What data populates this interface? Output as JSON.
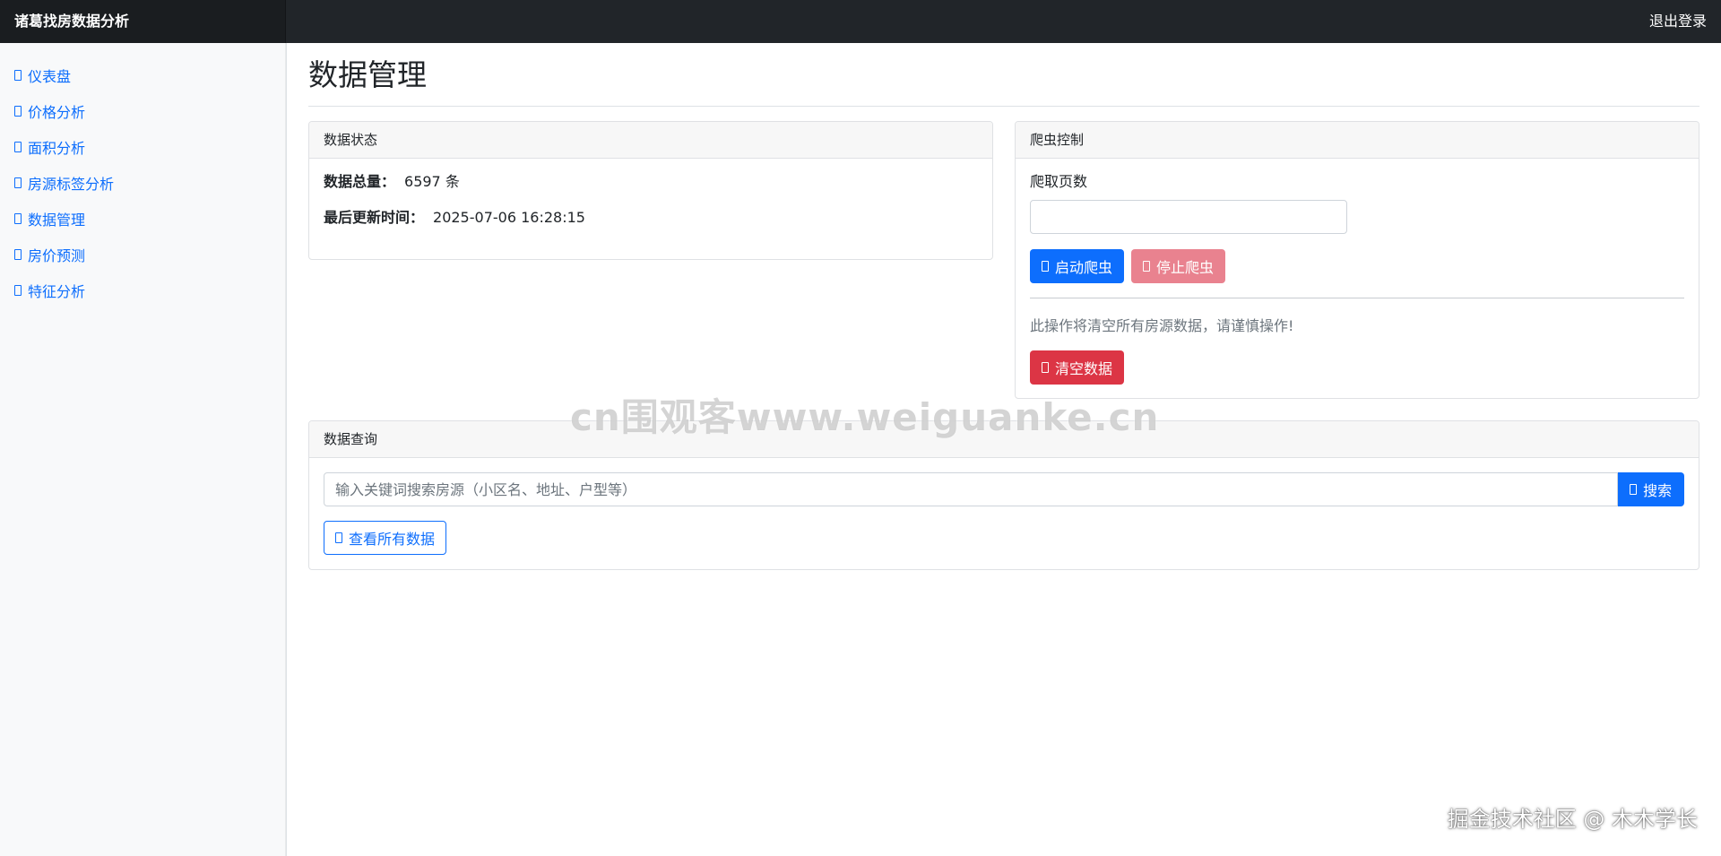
{
  "header": {
    "brand": "诸葛找房数据分析",
    "logout": "退出登录"
  },
  "sidebar": {
    "items": [
      {
        "icon": "dashboard-icon",
        "label": "仪表盘"
      },
      {
        "icon": "price-icon",
        "label": "价格分析"
      },
      {
        "icon": "area-icon",
        "label": "面积分析"
      },
      {
        "icon": "tag-icon",
        "label": "房源标签分析"
      },
      {
        "icon": "database-icon",
        "label": "数据管理"
      },
      {
        "icon": "prediction-icon",
        "label": "房价预测"
      },
      {
        "icon": "feature-icon",
        "label": "特征分析"
      }
    ]
  },
  "page": {
    "title": "数据管理"
  },
  "status_card": {
    "title": "数据状态",
    "total_label": "数据总量：",
    "total_value": "6597 条",
    "updated_label": "最后更新时间：",
    "updated_value": "2025-07-06 16:28:15"
  },
  "crawler_card": {
    "title": "爬虫控制",
    "pages_label": "爬取页数",
    "pages_value": "",
    "start_label": "启动爬虫",
    "stop_label": "停止爬虫",
    "warning": "此操作将清空所有房源数据，请谨慎操作!",
    "clear_label": "清空数据"
  },
  "query_card": {
    "title": "数据查询",
    "search_placeholder": "输入关键词搜索房源（小区名、地址、户型等）",
    "search_label": "搜索",
    "view_all_label": "查看所有数据"
  },
  "overlay": {
    "watermark": "cn围观客www.weiguanke.cn",
    "footer": "掘金技术社区 @ 木木学长"
  },
  "colors": {
    "primary": "#0d6efd",
    "danger": "#dc3545",
    "danger_disabled": "#e9828f",
    "topbar": "#212529",
    "sidebar_bg": "#f8f9fa"
  }
}
